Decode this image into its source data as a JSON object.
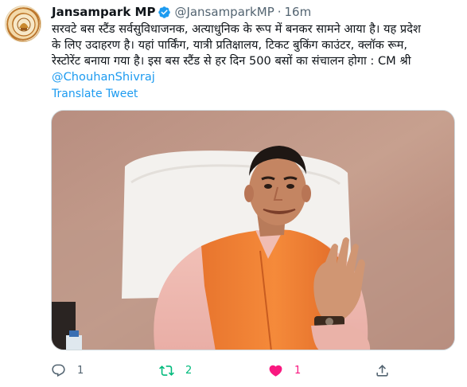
{
  "tweet": {
    "display_name": "Jansampark MP",
    "handle": "@JansamparkMP",
    "separator": "·",
    "time": "16m",
    "text_lines": [
      "सरवटे बस स्टैंड सर्वसुविधाजनक, अत्याधुनिक के रूप में बनकर सामने आया है। यह प्रदेश",
      "के लिए उदाहरण है। यहां पार्किंग, यात्री प्रतिक्षालय, टिकट बुकिंग काउंटर, क्लॉक रूम,",
      "रेस्टोरेंट बनाया गया है। इस बस स्टैंड से हर दिन 500 बसों का संचालन होगा : CM श्री"
    ],
    "mention": "@ChouhanShivraj",
    "translate_label": "Translate Tweet"
  },
  "actions": {
    "reply_count": "1",
    "retweet_count": "2",
    "like_count": "1"
  },
  "icons": {
    "verified": "verified-badge-icon",
    "reply": "reply-icon",
    "retweet": "retweet-icon",
    "like": "heart-icon",
    "share": "share-icon"
  },
  "colors": {
    "accent": "#1d9bf0",
    "retweet": "#00ba7c",
    "like": "#f91880",
    "secondary_text": "#536471"
  }
}
